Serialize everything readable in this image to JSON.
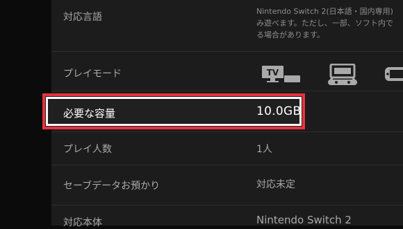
{
  "rows": [
    {
      "label": "対応言語"
    },
    {
      "label": "プレイモード"
    },
    {
      "label": "必要な容量",
      "value": "10.0GB"
    },
    {
      "label": "プレイ人数",
      "value": "1人"
    },
    {
      "label": "セーブデータお預かり",
      "value": "対応未定"
    },
    {
      "label": "対応本体",
      "value": "Nintendo Switch 2"
    }
  ],
  "language_description": {
    "line1": "Nintendo Switch 2(日本語・国内専用)",
    "line2": "み遊べます。ただし、一部、ソフト内で",
    "line3": "る場合があります。"
  },
  "play_modes": {
    "tv_label": "TV",
    "icons": [
      "tv-mode-icon",
      "tabletop-mode-icon",
      "handheld-mode-icon"
    ]
  },
  "colors": {
    "highlight_red": "#e8323c",
    "highlight_white": "#ffffff",
    "background": "#0b0b0b",
    "panel": "#1c1c1c",
    "text_dim": "#a9a9a9"
  }
}
